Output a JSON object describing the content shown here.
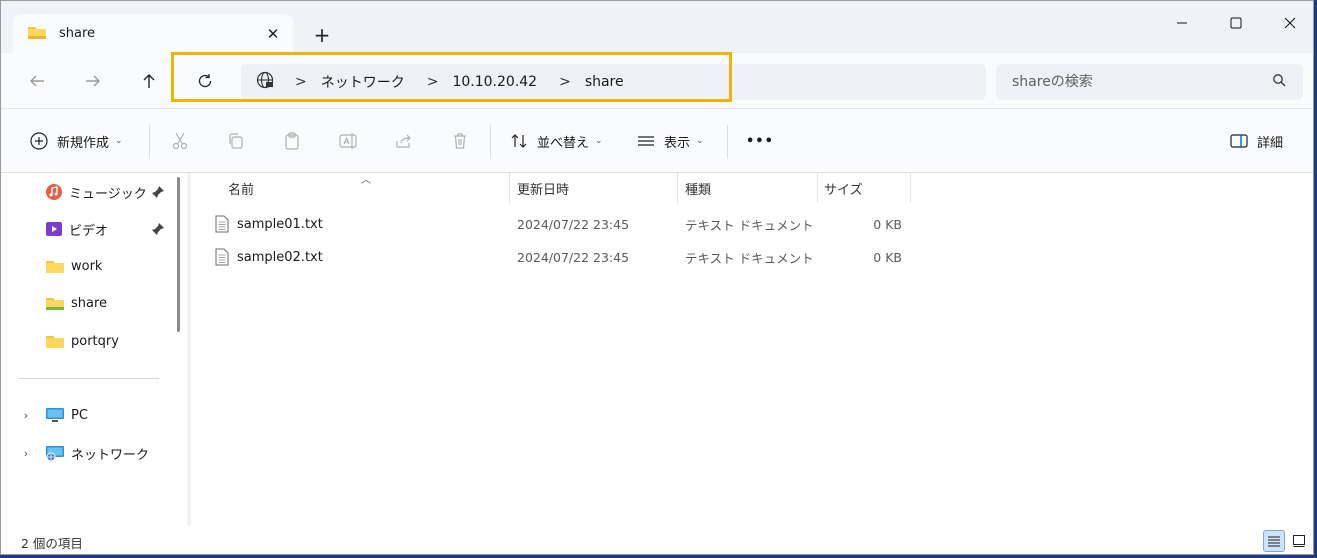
{
  "tab": {
    "title": "share",
    "close_glyph": "✕",
    "new_tab_glyph": "+"
  },
  "window_controls": {
    "minimize": "—",
    "maximize": "☐",
    "close": "✕"
  },
  "address": {
    "breadcrumbs": [
      "ネットワーク",
      "10.10.20.42",
      "share"
    ],
    "separator": ">",
    "highlight_color": "#f0b30a"
  },
  "search": {
    "placeholder": "shareの検索"
  },
  "commandbar": {
    "new_label": "新規作成",
    "sort_label": "並べ替え",
    "view_label": "表示",
    "more_label": "•••",
    "details_label": "詳細"
  },
  "sidebar": {
    "quick_items": [
      {
        "label": "ミュージック",
        "icon": "music-icon",
        "pinned": true
      },
      {
        "label": "ビデオ",
        "icon": "video-icon",
        "pinned": true
      },
      {
        "label": "work",
        "icon": "folder-icon",
        "pinned": false
      },
      {
        "label": "share",
        "icon": "folder-icon",
        "pinned": false
      },
      {
        "label": "portqry",
        "icon": "folder-icon",
        "pinned": false
      }
    ],
    "tree_items": [
      {
        "label": "PC",
        "icon": "pc-icon"
      },
      {
        "label": "ネットワーク",
        "icon": "network-icon"
      }
    ]
  },
  "filelist": {
    "columns": [
      "名前",
      "更新日時",
      "種類",
      "サイズ"
    ],
    "rows": [
      {
        "name": "sample01.txt",
        "modified": "2024/07/22 23:45",
        "type": "テキスト ドキュメント",
        "size": "0 KB"
      },
      {
        "name": "sample02.txt",
        "modified": "2024/07/22 23:45",
        "type": "テキスト ドキュメント",
        "size": "0 KB"
      }
    ]
  },
  "status": {
    "item_count": "2 個の項目"
  },
  "colors": {
    "accent": "#0067c0",
    "folder": "#f4c542",
    "highlight": "#f0b30a"
  }
}
